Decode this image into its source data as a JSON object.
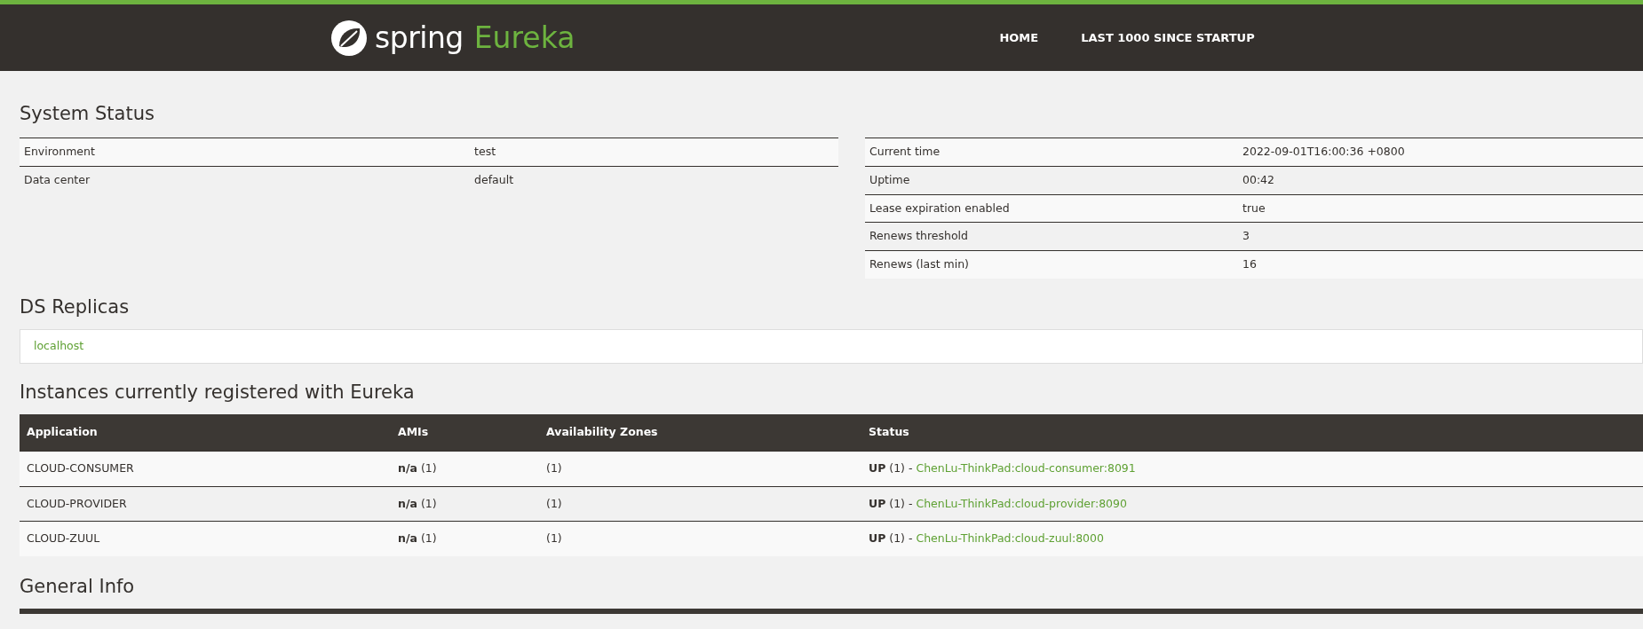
{
  "navbar": {
    "brand": "spring",
    "product": "Eureka",
    "links": [
      {
        "label": "HOME"
      },
      {
        "label": "LAST 1000 SINCE STARTUP"
      }
    ]
  },
  "system_status": {
    "title": "System Status",
    "left_table": [
      {
        "label": "Environment",
        "value": "test"
      },
      {
        "label": "Data center",
        "value": "default"
      }
    ],
    "right_table": [
      {
        "label": "Current time",
        "value": "2022-09-01T16:00:36 +0800"
      },
      {
        "label": "Uptime",
        "value": "00:42"
      },
      {
        "label": "Lease expiration enabled",
        "value": "true"
      },
      {
        "label": "Renews threshold",
        "value": "3"
      },
      {
        "label": "Renews (last min)",
        "value": "16"
      }
    ]
  },
  "ds_replicas": {
    "title": "DS Replicas",
    "items": [
      {
        "label": "localhost"
      }
    ]
  },
  "instances": {
    "title": "Instances currently registered with Eureka",
    "columns": [
      "Application",
      "AMIs",
      "Availability Zones",
      "Status"
    ],
    "rows": [
      {
        "application": "CLOUD-CONSUMER",
        "amis": "**n/a** (1)",
        "zones": "(1)",
        "status": "**UP** (1) - ",
        "instance": "ChenLu-ThinkPad:cloud-consumer:8091"
      },
      {
        "application": "CLOUD-PROVIDER",
        "amis": "**n/a** (1)",
        "zones": "(1)",
        "status": "**UP** (1) - ",
        "instance": "ChenLu-ThinkPad:cloud-provider:8090"
      },
      {
        "application": "CLOUD-ZUUL",
        "amis": "**n/a** (1)",
        "zones": "(1)",
        "status": "**UP** (1) - ",
        "instance": "ChenLu-ThinkPad:cloud-zuul:8000"
      }
    ]
  },
  "general_info": {
    "title": "General Info"
  }
}
